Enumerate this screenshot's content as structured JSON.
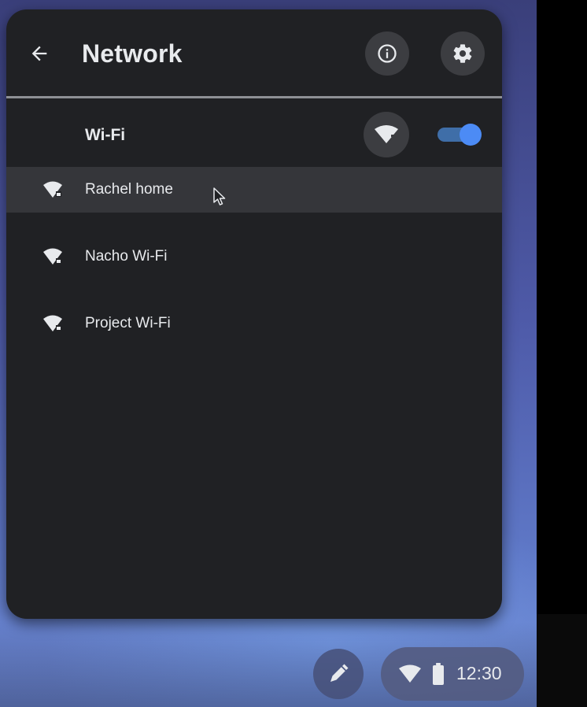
{
  "panel": {
    "title": "Network",
    "back_icon": "arrow-left-icon",
    "info_icon": "info-icon",
    "settings_icon": "gear-icon"
  },
  "wifi": {
    "label": "Wi-Fi",
    "icon": "wifi-icon",
    "enabled": true,
    "toggle_color": "#4c8bf5"
  },
  "networks": [
    {
      "name": "Rachel home",
      "icon": "wifi-secure-icon",
      "hovered": true
    },
    {
      "name": "Nacho Wi-Fi",
      "icon": "wifi-secure-icon",
      "hovered": false
    },
    {
      "name": "Project Wi-Fi",
      "icon": "wifi-secure-icon",
      "hovered": false
    }
  ],
  "shelf": {
    "pen_icon": "stylus-icon",
    "wifi_icon": "wifi-icon",
    "battery_icon": "battery-icon",
    "time": "12:30"
  },
  "colors": {
    "panel_bg": "#202124",
    "accent": "#4c8bf5",
    "text": "#e8eaed"
  }
}
